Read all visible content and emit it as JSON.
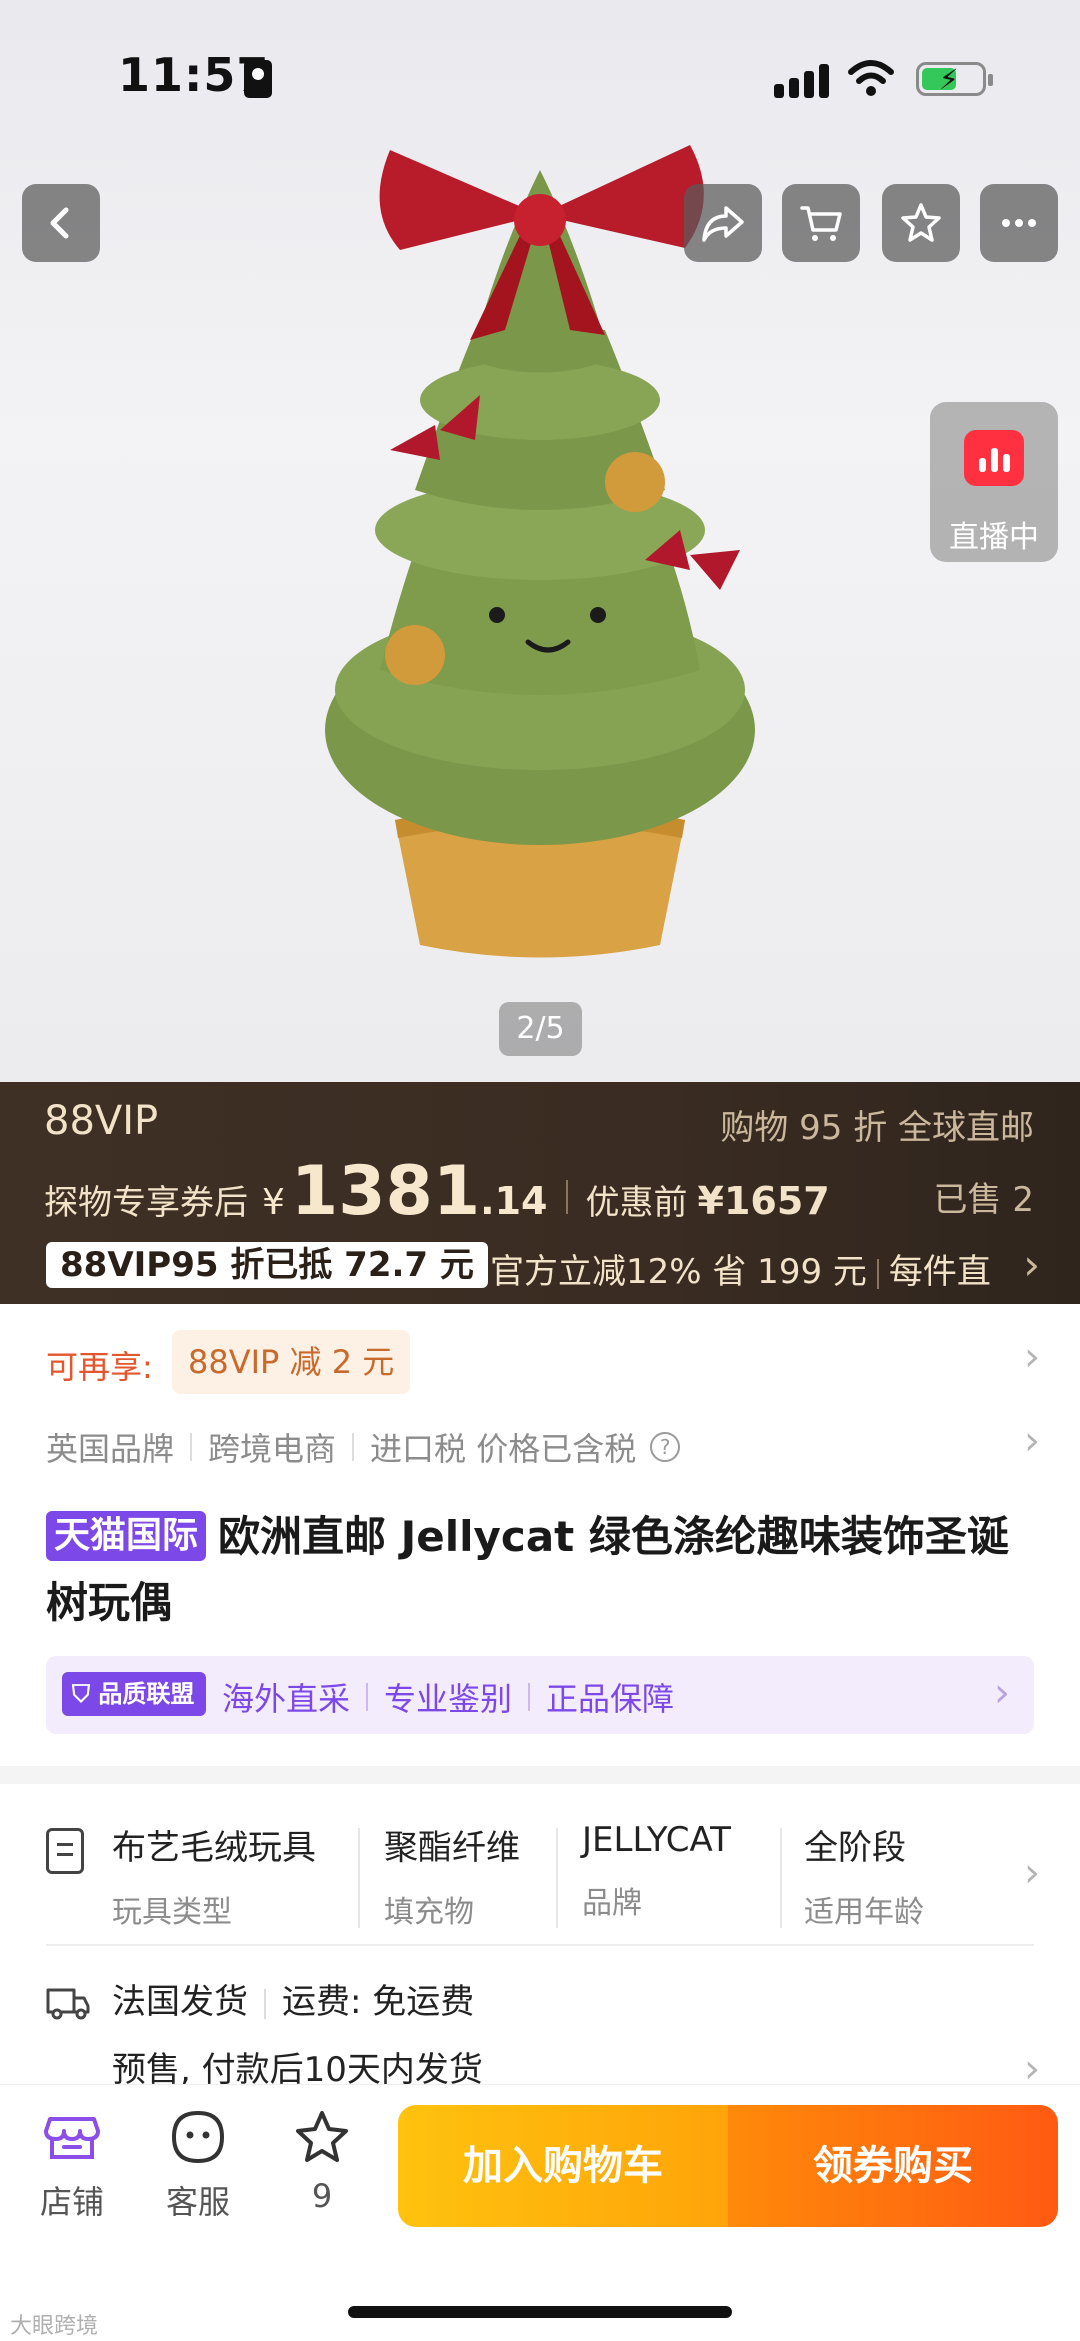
{
  "status_bar": {
    "time": "11:57"
  },
  "hero": {
    "page_indicator": "2/5",
    "live_label": "直播中"
  },
  "vip": {
    "title": "88VIP",
    "right_text": "购物 95 折 全球直邮",
    "price_prefix": "探物专享券后",
    "currency": "¥",
    "price_int": "1381",
    "price_dec": ".14",
    "before_label": "优惠前",
    "before_value": "¥1657",
    "sold": "已售 2",
    "tag": "88VIP95 折已抵 72.7 元",
    "offer_a": "官方立减12% 省 199 元",
    "offer_b": "每件直"
  },
  "again": {
    "label": "可再享:",
    "tag": "88VIP 减 2 元"
  },
  "meta": {
    "items": [
      "英国品牌",
      "跨境电商",
      "进口税 价格已含税"
    ],
    "help": "?"
  },
  "product": {
    "store_tag": "天猫国际",
    "title": "欧洲直邮 Jellycat 绿色涤纶趣味装饰圣诞树玩偶"
  },
  "quality": {
    "badge": "品质联盟",
    "items": [
      "海外直采",
      "专业鉴别",
      "正品保障"
    ]
  },
  "attributes": [
    {
      "value": "布艺毛绒玩具",
      "key": "玩具类型"
    },
    {
      "value": "聚酯纤维",
      "key": "填充物"
    },
    {
      "value": "JELLYCAT",
      "key": "品牌"
    },
    {
      "value": "全阶段",
      "key": "适用年龄"
    }
  ],
  "shipping": {
    "origin": "法国发货",
    "fee": "运费: 免运费",
    "note": "预售, 付款后10天内发货"
  },
  "bottom_bar": {
    "store_label": "店铺",
    "service_label": "客服",
    "fav_count": "9",
    "cart_label": "加入购物车",
    "buy_label": "领券购买"
  },
  "watermark": "大眼跨境",
  "colors": {
    "accent_purple": "#7d48e8",
    "vip_bg": "#3f3025",
    "cart": "#ffb30d",
    "buy": "#ff6a0f",
    "price_red": "#e4572e"
  }
}
